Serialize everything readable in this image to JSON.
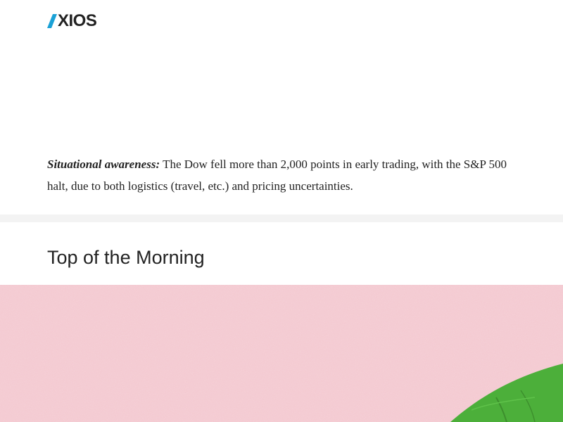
{
  "header": {
    "logo_text": "XIOS",
    "logo_mark_color": "#1aa1d6"
  },
  "story": {
    "lead": "Situational awareness:",
    "line1_rest": " The Dow fell more than 2,000 points in early trading, with the S&P 500",
    "line2": "halt, due to both logistics (travel, etc.) and pricing uncertainties."
  },
  "section": {
    "title": "Top of the Morning"
  },
  "hero_image": {
    "background_color": "#f3c6ce",
    "object_color": "#4caf3a",
    "object_icon": "green-fabric-object"
  }
}
